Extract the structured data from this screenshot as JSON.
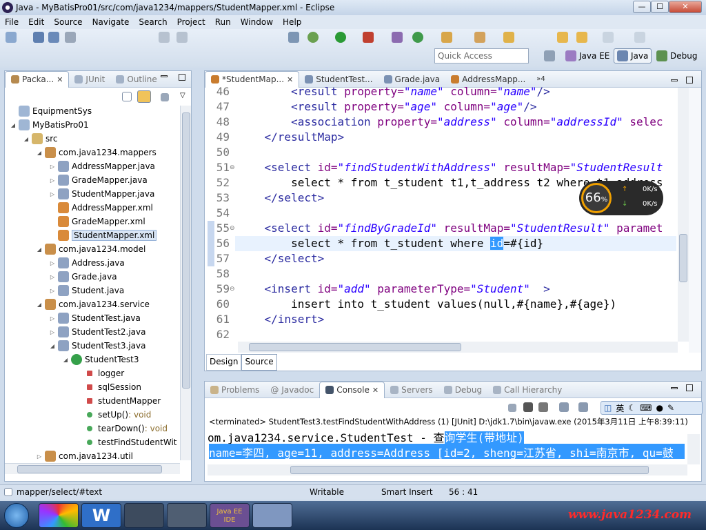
{
  "window": {
    "title": "Java - MyBatisPro01/src/com/java1234/mappers/StudentMapper.xml - Eclipse",
    "min": "—",
    "max": "☐",
    "close": "✕"
  },
  "menu": [
    "File",
    "Edit",
    "Source",
    "Navigate",
    "Search",
    "Project",
    "Run",
    "Window",
    "Help"
  ],
  "toolbar": {
    "quick_access_placeholder": "Quick Access",
    "perspectives": [
      {
        "label": "Java EE",
        "icon": "java-ee-perspective-icon"
      },
      {
        "label": "Java",
        "icon": "java-perspective-icon",
        "active": true
      },
      {
        "label": "Debug",
        "icon": "debug-perspective-icon"
      }
    ]
  },
  "left_tabs": [
    {
      "label": "Packa...",
      "active": true,
      "close": "✕"
    },
    {
      "label": "JUnit"
    },
    {
      "label": "Outline"
    }
  ],
  "tree": [
    {
      "label": "EquipmentSys",
      "indent": 0,
      "icon": "project-icon",
      "twisty": ""
    },
    {
      "label": "MyBatisPro01",
      "indent": 0,
      "icon": "project-icon",
      "twisty": "◢"
    },
    {
      "label": "src",
      "indent": 1,
      "icon": "source-folder-icon",
      "twisty": "◢"
    },
    {
      "label": "com.java1234.mappers",
      "indent": 2,
      "icon": "package-icon",
      "twisty": "◢"
    },
    {
      "label": "AddressMapper.java",
      "indent": 3,
      "icon": "java-file-icon",
      "twisty": "▷"
    },
    {
      "label": "GradeMapper.java",
      "indent": 3,
      "icon": "java-file-icon",
      "twisty": "▷"
    },
    {
      "label": "StudentMapper.java",
      "indent": 3,
      "icon": "java-file-icon",
      "twisty": "▷"
    },
    {
      "label": "AddressMapper.xml",
      "indent": 3,
      "icon": "xml-file-icon",
      "twisty": ""
    },
    {
      "label": "GradeMapper.xml",
      "indent": 3,
      "icon": "xml-file-icon",
      "twisty": ""
    },
    {
      "label": "StudentMapper.xml",
      "indent": 3,
      "icon": "xml-file-icon",
      "twisty": "",
      "selected": true
    },
    {
      "label": "com.java1234.model",
      "indent": 2,
      "icon": "package-icon",
      "twisty": "◢"
    },
    {
      "label": "Address.java",
      "indent": 3,
      "icon": "java-file-icon",
      "twisty": "▷"
    },
    {
      "label": "Grade.java",
      "indent": 3,
      "icon": "java-file-icon",
      "twisty": "▷"
    },
    {
      "label": "Student.java",
      "indent": 3,
      "icon": "java-file-icon",
      "twisty": "▷"
    },
    {
      "label": "com.java1234.service",
      "indent": 2,
      "icon": "package-icon",
      "twisty": "◢"
    },
    {
      "label": "StudentTest.java",
      "indent": 3,
      "icon": "java-file-icon",
      "twisty": "▷"
    },
    {
      "label": "StudentTest2.java",
      "indent": 3,
      "icon": "java-file-icon",
      "twisty": "▷"
    },
    {
      "label": "StudentTest3.java",
      "indent": 3,
      "icon": "java-file-icon",
      "twisty": "◢"
    },
    {
      "label": "StudentTest3",
      "indent": 4,
      "icon": "class-icon",
      "twisty": "◢"
    },
    {
      "label": "logger",
      "indent": 5,
      "icon": "private-field-icon",
      "twisty": ""
    },
    {
      "label": "sqlSession",
      "indent": 5,
      "icon": "private-field-icon",
      "twisty": ""
    },
    {
      "label": "studentMapper",
      "indent": 5,
      "icon": "private-field-icon",
      "twisty": ""
    },
    {
      "label": "setUp()",
      "suffix": " : void",
      "indent": 5,
      "icon": "public-method-icon",
      "twisty": ""
    },
    {
      "label": "tearDown()",
      "suffix": " : void",
      "indent": 5,
      "icon": "public-method-icon",
      "twisty": ""
    },
    {
      "label": "testFindStudentWit",
      "indent": 5,
      "icon": "public-method-icon",
      "twisty": ""
    },
    {
      "label": "com.java1234.util",
      "indent": 2,
      "icon": "package-icon",
      "twisty": "▷"
    }
  ],
  "editor_tabs": [
    {
      "label": "*StudentMap...",
      "active": true,
      "close": "✕",
      "icon": "xml-file-icon"
    },
    {
      "label": "StudentTest...",
      "icon": "java-file-icon"
    },
    {
      "label": "Grade.java",
      "icon": "java-file-icon"
    },
    {
      "label": "AddressMapp...",
      "icon": "xml-file-icon"
    },
    {
      "label": "»4"
    }
  ],
  "code_lines": [
    {
      "n": "46",
      "fold": "",
      "parts": [
        [
          "tag",
          "        <result "
        ],
        [
          "attr",
          "property="
        ],
        [
          "val",
          "\"name\" "
        ],
        [
          "attr",
          "column="
        ],
        [
          "val",
          "\"name\""
        ],
        [
          "tag",
          "/>"
        ]
      ]
    },
    {
      "n": "47",
      "fold": "",
      "parts": [
        [
          "tag",
          "        <result "
        ],
        [
          "attr",
          "property="
        ],
        [
          "val",
          "\"age\" "
        ],
        [
          "attr",
          "column="
        ],
        [
          "val",
          "\"age\""
        ],
        [
          "tag",
          "/>"
        ]
      ]
    },
    {
      "n": "48",
      "fold": "",
      "parts": [
        [
          "tag",
          "        <association "
        ],
        [
          "attr",
          "property="
        ],
        [
          "val",
          "\"address\" "
        ],
        [
          "attr",
          "column="
        ],
        [
          "val",
          "\"addressId\" "
        ],
        [
          "attr",
          "selec"
        ]
      ]
    },
    {
      "n": "49",
      "fold": "",
      "parts": [
        [
          "tag",
          "    </resultMap>"
        ]
      ]
    },
    {
      "n": "50",
      "fold": "",
      "parts": []
    },
    {
      "n": "51",
      "fold": "⊖",
      "parts": [
        [
          "tag",
          "    <select "
        ],
        [
          "attr",
          "id="
        ],
        [
          "val",
          "\"findStudentWithAddress\" "
        ],
        [
          "attr",
          "resultMap="
        ],
        [
          "val",
          "\"StudentResult"
        ]
      ]
    },
    {
      "n": "52",
      "fold": "",
      "parts": [
        [
          "txt",
          "        select * from t_student t1,t_address t2 where t1.address"
        ]
      ]
    },
    {
      "n": "53",
      "fold": "",
      "parts": [
        [
          "tag",
          "    </select>"
        ]
      ]
    },
    {
      "n": "54",
      "fold": "",
      "parts": []
    },
    {
      "n": "55",
      "fold": "⊖",
      "parts": [
        [
          "tag",
          "    <select "
        ],
        [
          "attr",
          "id="
        ],
        [
          "val",
          "\"findByGradeId\" "
        ],
        [
          "attr",
          "resultMap="
        ],
        [
          "val",
          "\"StudentResult\" "
        ],
        [
          "attr",
          "paramet"
        ]
      ]
    },
    {
      "n": "56",
      "fold": "",
      "parts": [
        [
          "txt",
          "        select * from t_student where "
        ],
        [
          "sel",
          "id"
        ],
        [
          "txt",
          "=#{id}"
        ]
      ]
    },
    {
      "n": "57",
      "fold": "",
      "parts": [
        [
          "tag",
          "    </select>"
        ]
      ]
    },
    {
      "n": "58",
      "fold": "",
      "parts": []
    },
    {
      "n": "59",
      "fold": "⊖",
      "parts": [
        [
          "tag",
          "    <insert "
        ],
        [
          "attr",
          "id="
        ],
        [
          "val",
          "\"add\" "
        ],
        [
          "attr",
          "parameterType="
        ],
        [
          "val",
          "\"Student\" "
        ],
        [
          "tag",
          " >"
        ]
      ]
    },
    {
      "n": "60",
      "fold": "",
      "parts": [
        [
          "txt",
          "        insert into t_student values(null,#{name},#{age})"
        ]
      ]
    },
    {
      "n": "61",
      "fold": "",
      "parts": [
        [
          "tag",
          "    </insert>"
        ]
      ]
    },
    {
      "n": "62",
      "fold": "",
      "parts": []
    }
  ],
  "editor_bottom_tabs": [
    "Design",
    "Source"
  ],
  "net_widget": {
    "percent": "66",
    "pct_sign": "%",
    "up": "0K/s",
    "down": "0K/s"
  },
  "console_tabs": [
    {
      "label": "Problems",
      "icon": "problems-icon"
    },
    {
      "label": "Javadoc",
      "icon": "javadoc-icon"
    },
    {
      "label": "Console",
      "icon": "console-icon",
      "active": true,
      "close": "✕"
    },
    {
      "label": "Servers",
      "icon": "servers-icon"
    },
    {
      "label": "Debug",
      "icon": "debug-icon"
    },
    {
      "label": "Call Hierarchy",
      "icon": "call-hierarchy-icon"
    }
  ],
  "ime": {
    "lang": "英"
  },
  "console": {
    "terminated": "<terminated> StudentTest3.testFindStudentWithAddress (1) [JUnit] D:\\jdk1.7\\bin\\javaw.exe (2015年3月11日 上午8:39:11)",
    "line1_a": "om.java1234.service.StudentTest - 查",
    "line1_b": "询学生(带地址)",
    "line2": " name=李四, age=11, address=Address [id=2, sheng=江苏省, shi=南京市, qu=鼓"
  },
  "status": {
    "path": "mapper/select/#text",
    "mode": "Writable",
    "insert": "Smart Insert",
    "pos": "56 : 41"
  },
  "taskbar": {
    "watermark": "www.java1234.com",
    "apps": [
      "start-orb-icon",
      "picasa-icon",
      "wps-writer-icon",
      "terminal-icon",
      "java-app-icon",
      "java-ee-ide-icon",
      "dolphin-icon"
    ],
    "java_ee_label": "Java EE IDE"
  },
  "colors": {
    "selection": "#3399ff",
    "tag": "#2b2ba0",
    "attr": "#7f007f",
    "value": "#2a00ff"
  }
}
